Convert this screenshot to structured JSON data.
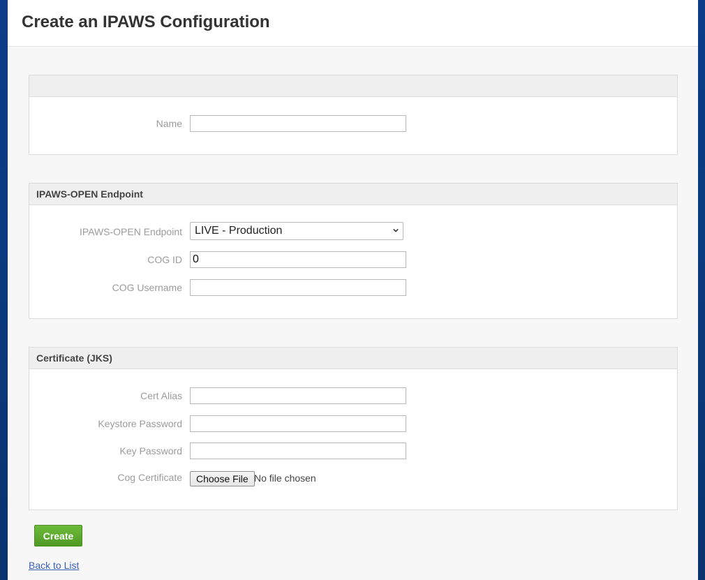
{
  "page": {
    "title": "Create an IPAWS Configuration"
  },
  "section_general": {
    "heading": "",
    "name_label": "Name",
    "name_value": ""
  },
  "section_endpoint": {
    "heading": "IPAWS-OPEN Endpoint",
    "endpoint_label": "IPAWS-OPEN Endpoint",
    "endpoint_selected": "LIVE - Production",
    "cog_id_label": "COG ID",
    "cog_id_value": "0",
    "cog_username_label": "COG Username",
    "cog_username_value": ""
  },
  "section_certificate": {
    "heading": "Certificate (JKS)",
    "cert_alias_label": "Cert Alias",
    "cert_alias_value": "",
    "keystore_password_label": "Keystore Password",
    "key_password_label": "Key Password",
    "cog_certificate_label": "Cog Certificate",
    "choose_file_label": "Choose File",
    "file_status": "No file chosen"
  },
  "actions": {
    "create_label": "Create",
    "back_label": "Back to List"
  },
  "colors": {
    "create_button": "#5aa82e",
    "link": "#3b5fb8",
    "background": "#0b3d8a"
  }
}
